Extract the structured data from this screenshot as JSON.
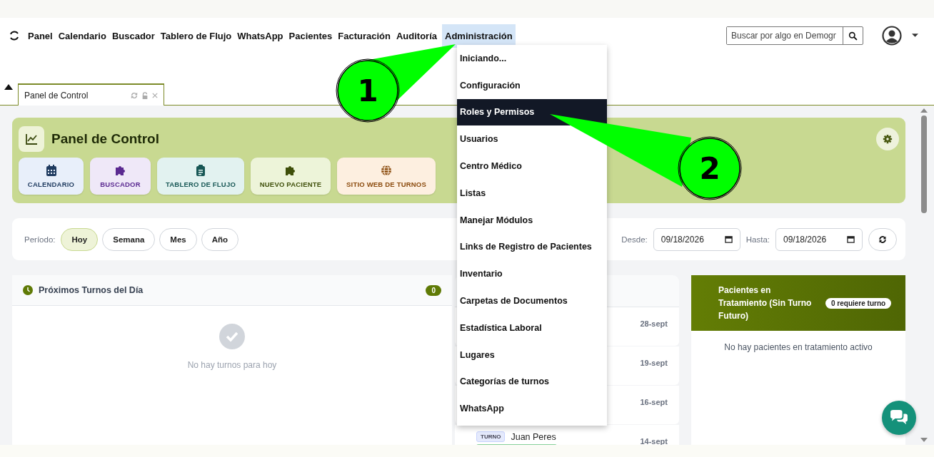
{
  "nav": {
    "items": [
      {
        "label": "Panel",
        "selected": false
      },
      {
        "label": "Calendario",
        "selected": false
      },
      {
        "label": "Buscador",
        "selected": false
      },
      {
        "label": "Tablero de Flujo",
        "selected": false
      },
      {
        "label": "WhatsApp",
        "selected": false
      },
      {
        "label": "Pacientes",
        "selected": false
      },
      {
        "label": "Facturación",
        "selected": false
      },
      {
        "label": "Auditoría",
        "selected": false
      },
      {
        "label": "Administración",
        "selected": true
      }
    ],
    "search": {
      "placeholder": "Buscar por algo en Demogr"
    }
  },
  "menu": {
    "items": [
      {
        "label": "Iniciando...",
        "selected": false
      },
      {
        "label": "Configuración",
        "selected": false
      },
      {
        "label": "Roles y Permisos",
        "selected": true
      },
      {
        "label": "Usuarios",
        "selected": false
      },
      {
        "label": "Centro Médico",
        "selected": false
      },
      {
        "label": "Listas",
        "selected": false
      },
      {
        "label": "Manejar Módulos",
        "selected": false
      },
      {
        "label": "Links de Registro de Pacientes",
        "selected": false
      },
      {
        "label": "Inventario",
        "selected": false
      },
      {
        "label": "Carpetas de Documentos",
        "selected": false
      },
      {
        "label": "Estadística Laboral",
        "selected": false
      },
      {
        "label": "Lugares",
        "selected": false
      },
      {
        "label": "Categorías de turnos",
        "selected": false
      },
      {
        "label": "WhatsApp",
        "selected": false
      }
    ]
  },
  "tabs": [
    {
      "label": "Panel de Control",
      "selected": true
    }
  ],
  "dashboard": {
    "title": "Panel de Control",
    "shortcuts": [
      {
        "label": "CALENDARIO",
        "kind": "calendar",
        "color": "#e8effa"
      },
      {
        "label": "BUSCADOR",
        "kind": "puzzle",
        "color": "#efe8f8"
      },
      {
        "label": "TABLERO DE FLUJO",
        "kind": "clipboard",
        "color": "#e2f2f0"
      },
      {
        "label": "NUEVO PACIENTE",
        "kind": "puzzle",
        "color": "#edf4d9"
      },
      {
        "label": "SITIO WEB DE TURNOS",
        "kind": "globe",
        "color": "#fdefe0"
      }
    ]
  },
  "filters": {
    "label": "Período:",
    "periods": [
      {
        "label": "Hoy",
        "selected": true
      },
      {
        "label": "Semana",
        "selected": false
      },
      {
        "label": "Mes",
        "selected": false
      },
      {
        "label": "Año",
        "selected": false
      }
    ],
    "from_label": "Desde:",
    "from_value": "09/18/2026",
    "to_label": "Hasta:",
    "to_value": "09/18/2026"
  },
  "upcoming": {
    "title": "Próximos Turnos del Día",
    "count": "0",
    "empty": "No hay turnos para hoy"
  },
  "list": {
    "rows": [
      {
        "date": "28-sept"
      },
      {
        "date": "19-sept"
      },
      {
        "date": "16-sept"
      },
      {
        "tag": "TURNO",
        "name": "Juan Peres",
        "date": "14-sept"
      }
    ]
  },
  "treatment": {
    "title": "Pacientes en Tratamiento (Sin Turno Futuro)",
    "badge": "0 requiere turno",
    "empty": "No hay pacientes en tratamiento activo"
  },
  "callouts": [
    "1",
    "2"
  ]
}
